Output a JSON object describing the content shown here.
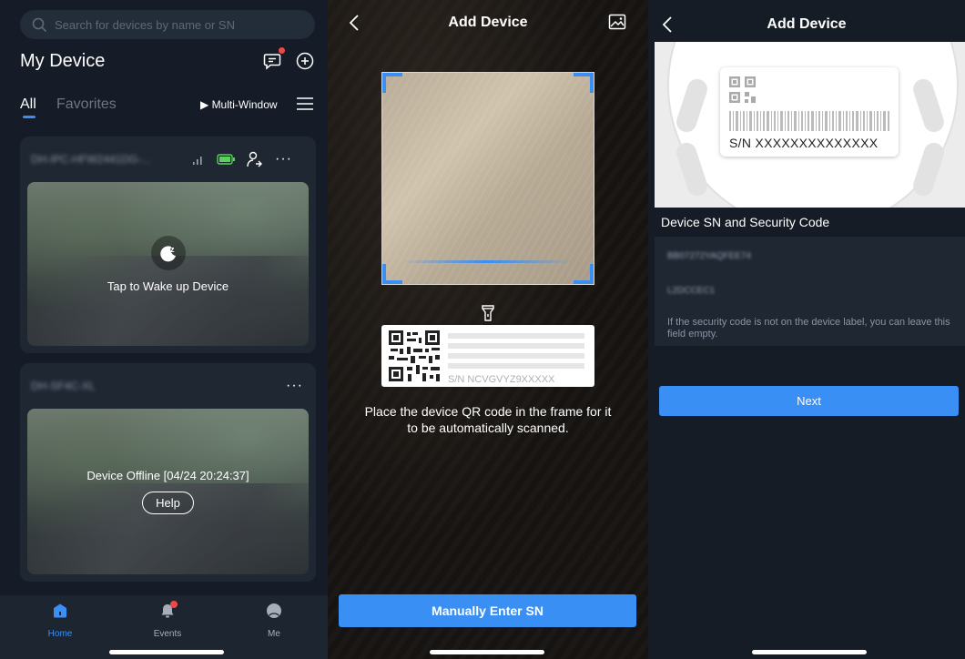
{
  "list_screen": {
    "search_placeholder": "Search for devices by name or SN",
    "title": "My Device",
    "tabs": [
      {
        "label": "All"
      },
      {
        "label": "Favorites"
      }
    ],
    "multi_window_label": "Multi-Window",
    "devices": [
      {
        "name": "DH-IPC-HFW2441DG-...",
        "status_text": "Tap to Wake up Device"
      },
      {
        "name": "DH-SF4C-XL",
        "status_text": "Device Offline [04/24 20:24:37]",
        "help_label": "Help"
      }
    ],
    "nav": [
      {
        "label": "Home",
        "active": true
      },
      {
        "label": "Events",
        "badge": true
      },
      {
        "label": "Me"
      }
    ]
  },
  "scan_screen": {
    "title": "Add Device",
    "sample_sn": "S/N  NCVGVYZ9XXXXX",
    "hint": "Place the device QR code in the frame for it to be automatically scanned.",
    "manual_button": "Manually Enter SN"
  },
  "sn_screen": {
    "title": "Add Device",
    "label_sn": "S/N  XXXXXXXXXXXXXX",
    "section_title": "Device SN and Security Code",
    "sn_value": "BB07272YAQFEE74",
    "security_code_value": "L2DCCEC1",
    "security_note": "If the security code is not on the device label, you can leave this field empty.",
    "next_button": "Next"
  },
  "colors": {
    "accent": "#3a8ff5",
    "badge": "#f04848",
    "dark_bg": "#151c27",
    "card_bg": "#1f2733"
  }
}
